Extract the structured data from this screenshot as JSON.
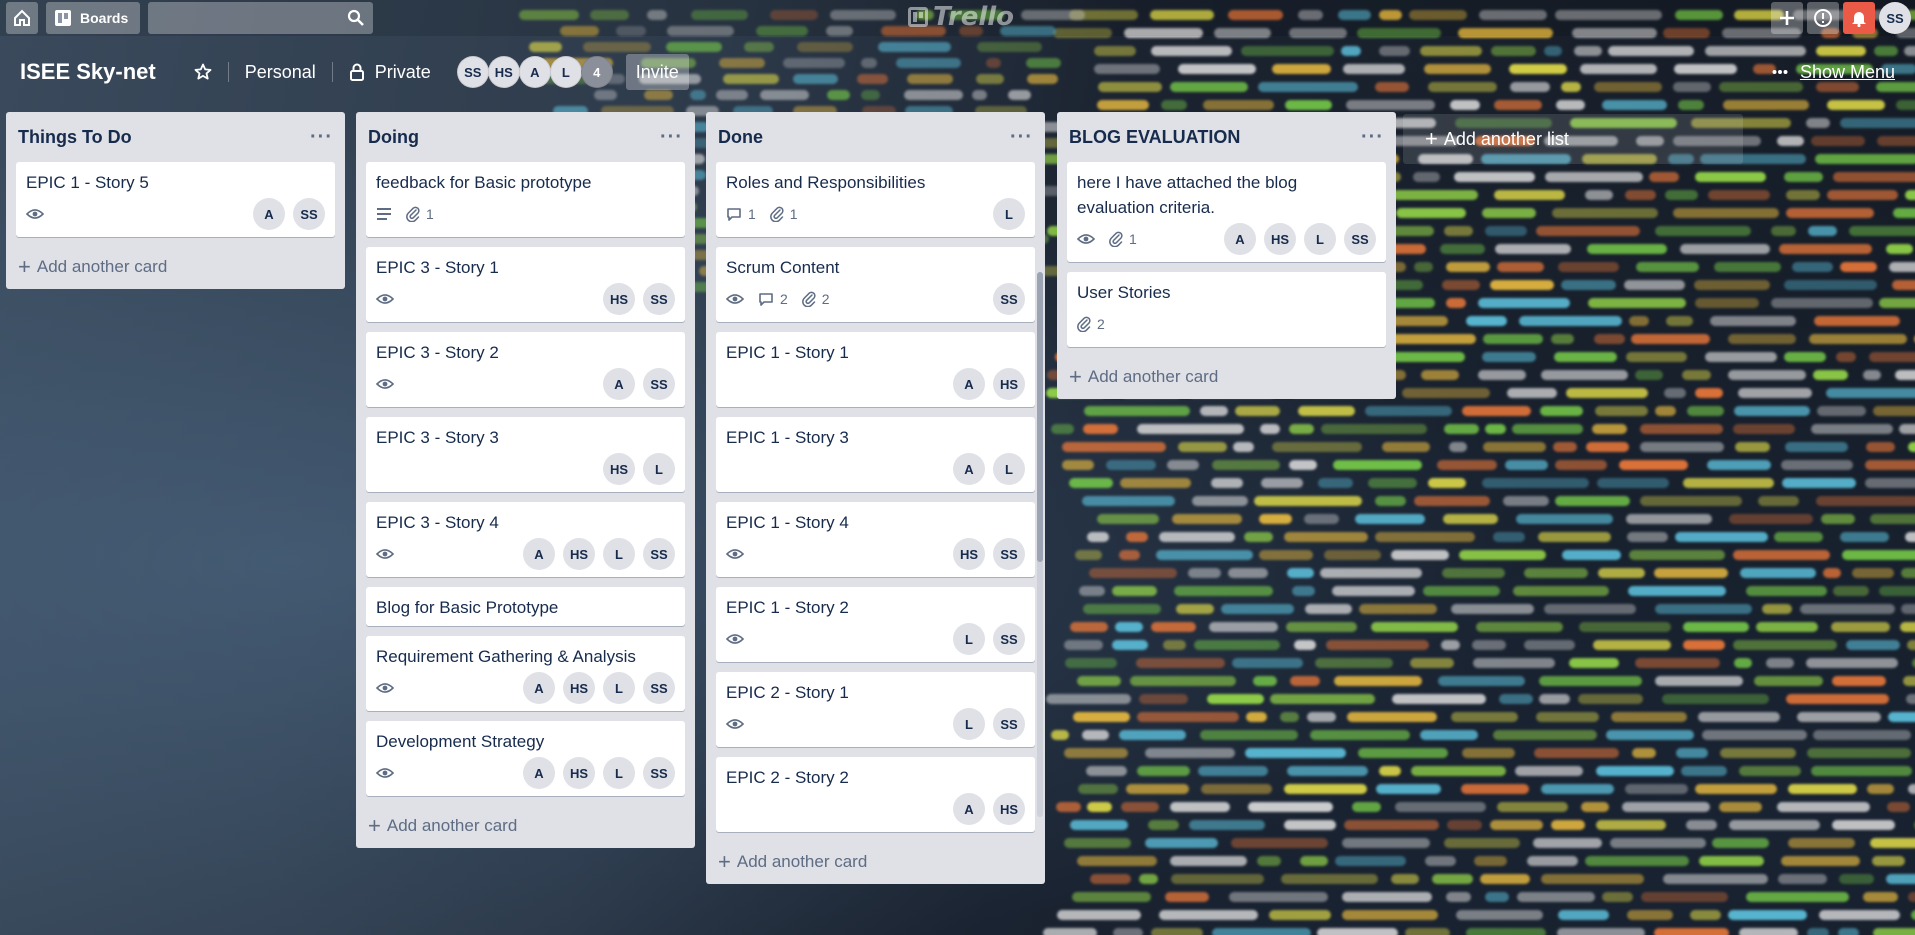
{
  "header": {
    "boards_label": "Boards",
    "search_value": "",
    "logo_text": "Trello",
    "user_initials": "SS"
  },
  "board": {
    "title": "ISEE Sky-net",
    "personal_label": "Personal",
    "privacy_label": "Private",
    "members": [
      "SS",
      "HS",
      "A",
      "L"
    ],
    "more_members": "4",
    "invite_label": "Invite",
    "show_menu_label": "Show Menu"
  },
  "lists": [
    {
      "title": "Things To Do",
      "cards": [
        {
          "title": "EPIC 1 - Story 5",
          "watch": true,
          "description": false,
          "comments": "",
          "attachments": "",
          "members": [
            "A",
            "SS"
          ]
        }
      ],
      "add_card_label": "Add another card"
    },
    {
      "title": "Doing",
      "cards": [
        {
          "title": "feedback for Basic prototype",
          "watch": false,
          "description": true,
          "comments": "",
          "attachments": "1",
          "members": []
        },
        {
          "title": "EPIC 3 - Story 1",
          "watch": true,
          "description": false,
          "comments": "",
          "attachments": "",
          "members": [
            "HS",
            "SS"
          ]
        },
        {
          "title": "EPIC 3 - Story 2",
          "watch": true,
          "description": false,
          "comments": "",
          "attachments": "",
          "members": [
            "A",
            "SS"
          ]
        },
        {
          "title": "EPIC 3 - Story 3",
          "watch": false,
          "description": false,
          "comments": "",
          "attachments": "",
          "members": [
            "HS",
            "L"
          ]
        },
        {
          "title": "EPIC 3 - Story 4",
          "watch": true,
          "description": false,
          "comments": "",
          "attachments": "",
          "members": [
            "A",
            "HS",
            "L",
            "SS"
          ]
        },
        {
          "title": "Blog for Basic Prototype",
          "watch": false,
          "description": false,
          "comments": "",
          "attachments": "",
          "members": []
        },
        {
          "title": "Requirement Gathering & Analysis",
          "watch": true,
          "description": false,
          "comments": "",
          "attachments": "",
          "members": [
            "A",
            "HS",
            "L",
            "SS"
          ]
        },
        {
          "title": "Development Strategy",
          "watch": true,
          "description": false,
          "comments": "",
          "attachments": "",
          "members": [
            "A",
            "HS",
            "L",
            "SS"
          ]
        }
      ],
      "add_card_label": "Add another card"
    },
    {
      "title": "Done",
      "cards": [
        {
          "title": "Roles and Responsibilities",
          "watch": false,
          "description": false,
          "comments": "1",
          "attachments": "1",
          "members": [
            "L"
          ]
        },
        {
          "title": "Scrum Content",
          "watch": true,
          "description": false,
          "comments": "2",
          "attachments": "2",
          "members": [
            "SS"
          ]
        },
        {
          "title": "EPIC 1 - Story 1",
          "watch": false,
          "description": false,
          "comments": "",
          "attachments": "",
          "members": [
            "A",
            "HS"
          ]
        },
        {
          "title": "EPIC 1 - Story 3",
          "watch": false,
          "description": false,
          "comments": "",
          "attachments": "",
          "members": [
            "A",
            "L"
          ]
        },
        {
          "title": "EPIC 1 - Story 4",
          "watch": true,
          "description": false,
          "comments": "",
          "attachments": "",
          "members": [
            "HS",
            "SS"
          ]
        },
        {
          "title": "EPIC 1 - Story 2",
          "watch": true,
          "description": false,
          "comments": "",
          "attachments": "",
          "members": [
            "L",
            "SS"
          ]
        },
        {
          "title": "EPIC 2 - Story 1",
          "watch": true,
          "description": false,
          "comments": "",
          "attachments": "",
          "members": [
            "L",
            "SS"
          ]
        },
        {
          "title": "EPIC 2 - Story 2",
          "watch": false,
          "description": false,
          "comments": "",
          "attachments": "",
          "members": [
            "A",
            "HS"
          ]
        }
      ],
      "add_card_label": "Add another card"
    },
    {
      "title": "BLOG EVALUATION",
      "cards": [
        {
          "title": "here I have attached the blog evaluation criteria.",
          "watch": true,
          "description": false,
          "comments": "",
          "attachments": "1",
          "members": [
            "A",
            "HS",
            "L",
            "SS"
          ]
        },
        {
          "title": "User Stories",
          "watch": false,
          "description": false,
          "comments": "",
          "attachments": "2",
          "members": []
        }
      ],
      "add_card_label": "Add another card"
    }
  ],
  "add_list_label": "Add another list",
  "colors": {
    "list_bg": "#dfe1e6",
    "notification": "#eb5a46",
    "text_primary": "#172b4d",
    "text_muted": "#5e6c84"
  },
  "icons": {
    "home": "home-icon",
    "boards": "boards-icon",
    "search": "search-icon",
    "add": "plus-icon",
    "info": "info-icon",
    "notifications": "bell-icon",
    "star": "star-icon",
    "private": "lock-icon",
    "menu": "ellipsis-icon",
    "watch": "eye-icon",
    "description": "description-icon",
    "comments": "comment-icon",
    "attachments": "paperclip-icon"
  }
}
